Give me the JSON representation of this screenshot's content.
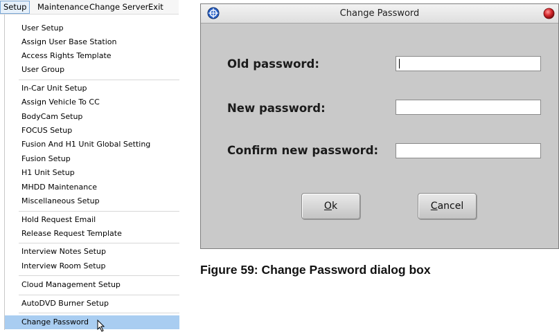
{
  "menubar": {
    "items": [
      "Setup",
      "Maintenance",
      "Change Server",
      "Exit"
    ],
    "active_index": 0
  },
  "dropdown": {
    "items": [
      "User Setup",
      "Assign User Base Station",
      "Access Rights Template",
      "User Group",
      "In-Car Unit Setup",
      "Assign Vehicle To CC",
      "BodyCam Setup",
      "FOCUS Setup",
      "Fusion And H1 Unit Global Setting",
      "Fusion Setup",
      "H1 Unit Setup",
      "MHDD Maintenance",
      "Miscellaneous Setup",
      "Hold Request Email",
      "Release Request Template",
      "Interview Notes Setup",
      "Interview Room Setup",
      "Cloud Management Setup",
      "AutoDVD Burner Setup",
      "Change Password"
    ],
    "highlighted": "Change Password"
  },
  "dialog": {
    "title": "Change Password",
    "fields": [
      {
        "label": "Old password:",
        "value": ""
      },
      {
        "label": "New password:",
        "value": ""
      },
      {
        "label": "Confirm new password:",
        "value": ""
      }
    ],
    "ok_mnemonic": "O",
    "ok_rest": "k",
    "cancel_mnemonic": "C",
    "cancel_rest": "ancel"
  },
  "caption": "Figure 59: Change Password dialog box",
  "colors": {
    "menu_highlight": "#a9cdf1",
    "dialog_bg": "#c9c9c9",
    "close_button": "#d4262b"
  }
}
